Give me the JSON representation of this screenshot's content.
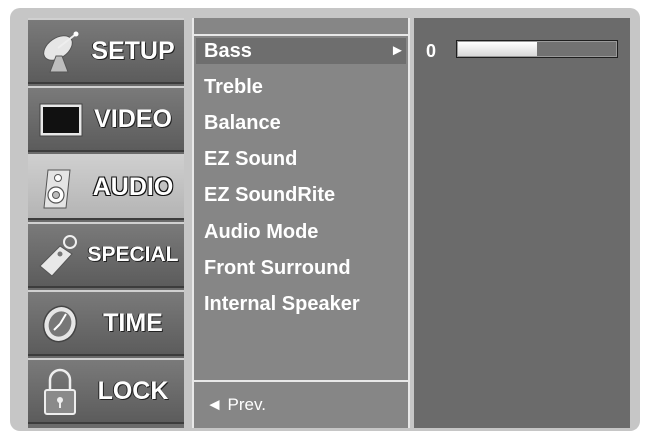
{
  "sidebar": {
    "items": [
      {
        "label": "SETUP",
        "icon": "satellite-dish-icon",
        "active": false
      },
      {
        "label": "VIDEO",
        "icon": "tv-screen-icon",
        "active": false
      },
      {
        "label": "AUDIO",
        "icon": "speaker-icon",
        "active": true
      },
      {
        "label": "SPECIAL",
        "icon": "key-tag-icon",
        "active": false
      },
      {
        "label": "TIME",
        "icon": "clock-icon",
        "active": false
      },
      {
        "label": "LOCK",
        "icon": "padlock-icon",
        "active": false
      }
    ]
  },
  "submenu": {
    "items": [
      {
        "label": "Bass",
        "selected": true
      },
      {
        "label": "Treble",
        "selected": false
      },
      {
        "label": "Balance",
        "selected": false
      },
      {
        "label": "EZ Sound",
        "selected": false
      },
      {
        "label": "EZ SoundRite",
        "selected": false
      },
      {
        "label": "Audio Mode",
        "selected": false
      },
      {
        "label": "Front Surround",
        "selected": false
      },
      {
        "label": "Internal Speaker",
        "selected": false
      }
    ],
    "selected_arrow": "►",
    "prev_label": "◄ Prev."
  },
  "value_panel": {
    "bass_value": "0",
    "bass_level_fraction": 0.5
  },
  "colors": {
    "frame": "#c6c6c6",
    "sidebar": "#6b6b6b",
    "sidebar_active": "#c4c4c4",
    "submenu": "#868686",
    "value_panel": "#6b6b6b"
  }
}
